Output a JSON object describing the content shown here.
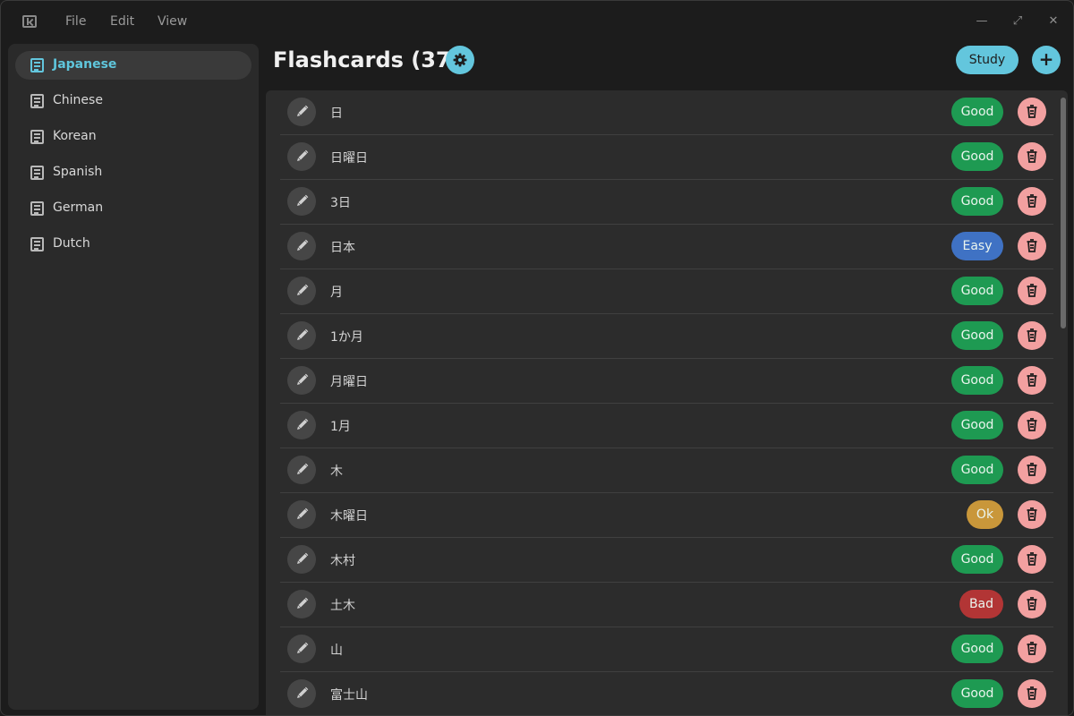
{
  "window": {
    "menu": [
      "File",
      "Edit",
      "View"
    ]
  },
  "sidebar": {
    "items": [
      {
        "label": "Japanese",
        "active": true
      },
      {
        "label": "Chinese",
        "active": false
      },
      {
        "label": "Korean",
        "active": false
      },
      {
        "label": "Spanish",
        "active": false
      },
      {
        "label": "German",
        "active": false
      },
      {
        "label": "Dutch",
        "active": false
      }
    ]
  },
  "header": {
    "title": "Flashcards (37)",
    "study_label": "Study",
    "add_label": "+"
  },
  "cards": [
    {
      "word": "日",
      "rating": "Good"
    },
    {
      "word": "日曜日",
      "rating": "Good"
    },
    {
      "word": "3日",
      "rating": "Good"
    },
    {
      "word": "日本",
      "rating": "Easy"
    },
    {
      "word": "月",
      "rating": "Good"
    },
    {
      "word": "1か月",
      "rating": "Good"
    },
    {
      "word": "月曜日",
      "rating": "Good"
    },
    {
      "word": "1月",
      "rating": "Good"
    },
    {
      "word": "木",
      "rating": "Good"
    },
    {
      "word": "木曜日",
      "rating": "Ok"
    },
    {
      "word": "木村",
      "rating": "Good"
    },
    {
      "word": "土木",
      "rating": "Bad"
    },
    {
      "word": "山",
      "rating": "Good"
    },
    {
      "word": "富士山",
      "rating": "Good"
    }
  ],
  "colors": {
    "accent": "#63c6dd",
    "good": "#1e9a52",
    "easy": "#3f72c4",
    "ok": "#c9973a",
    "bad": "#b23535",
    "delete": "#f2a0a0"
  },
  "icons": {
    "app": "sidebar-toggle-icon",
    "list_item": "document-icon",
    "settings": "gear-icon",
    "edit": "pencil-icon",
    "delete": "trash-icon"
  }
}
